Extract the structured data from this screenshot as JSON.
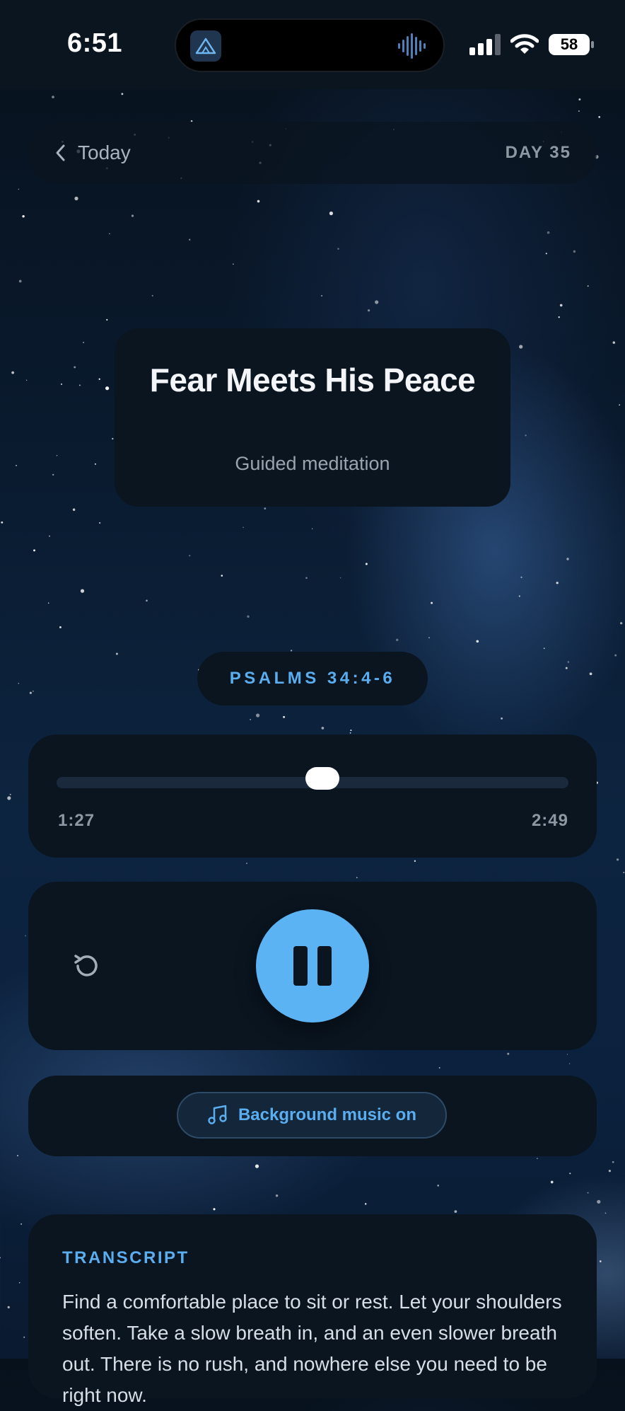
{
  "status_bar": {
    "time": "6:51",
    "battery": "58",
    "icons": [
      "app-logo-icon",
      "audio-wave-icon",
      "signal-icon",
      "wifi-icon",
      "battery-icon"
    ]
  },
  "header": {
    "back_label": "Today",
    "day_label": "DAY 35"
  },
  "session": {
    "title": "Fear Meets His Peace",
    "subtitle": "Guided meditation",
    "scripture": "PSALMS 34:4-6"
  },
  "player": {
    "current_time": "1:27",
    "total_time": "2:49",
    "progress": 0.52,
    "state": "playing"
  },
  "music": {
    "label": "Background music on"
  },
  "transcript": {
    "label": "TRANSCRIPT",
    "text": "Find a comfortable place to sit or rest. Let your shoulders soften. Take a slow breath in, and an even slower breath out. There is no rush, and nowhere else you need to be right now."
  },
  "colors": {
    "accent": "#5cb3f3",
    "card": "#0a1520",
    "text_muted": "#8e98a3"
  }
}
